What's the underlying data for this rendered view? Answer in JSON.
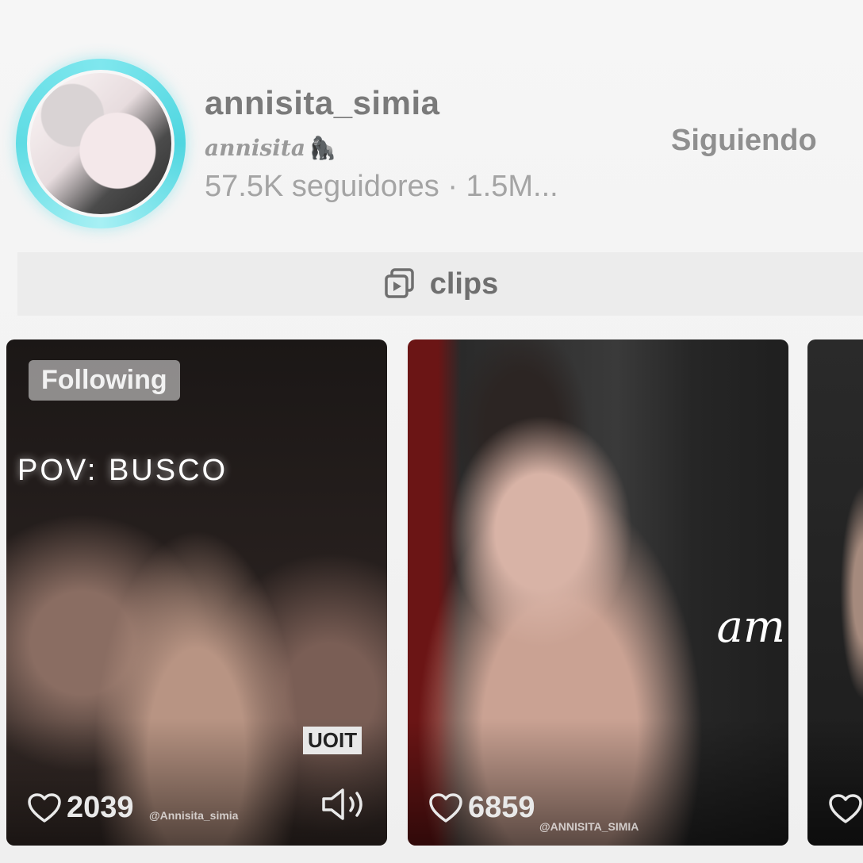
{
  "profile": {
    "username": "annisita_simia",
    "display_name": "annisita",
    "display_name_emoji": "🦍",
    "stats": "57.5K seguidores · 1.5M...",
    "follow_button": "Siguiendo"
  },
  "section": {
    "label": "clips",
    "icon": "clips-icon"
  },
  "clips": [
    {
      "badge": "Following",
      "overlay_text": "POV: BUSCO",
      "likes": "2039",
      "watermark": "@Annisita_simia",
      "sign_text": "UOIT",
      "sound_icon": "speaker-icon"
    },
    {
      "likes": "6859",
      "watermark": "@ANNISITA_SIMIA",
      "logo_text": "am"
    },
    {}
  ],
  "colors": {
    "ring": "#5fdce4",
    "text_muted": "#a4a4a4",
    "card_bg": "#1a1a1a"
  }
}
